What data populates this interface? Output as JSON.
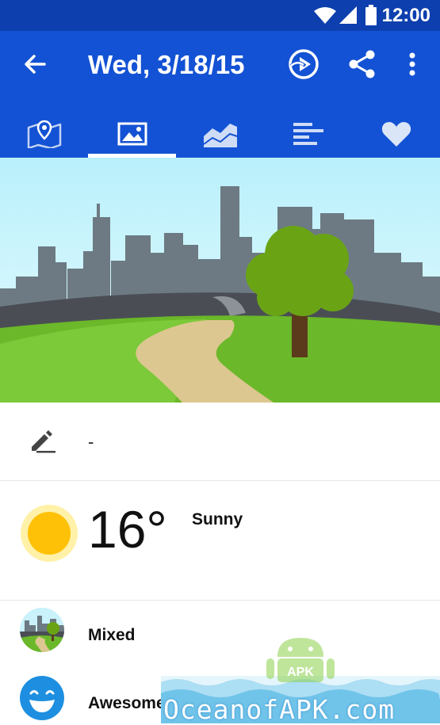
{
  "status": {
    "time": "12:00"
  },
  "toolbar": {
    "title": "Wed, 3/18/15",
    "back_icon": "arrow-back-icon",
    "actions": [
      "share-image-icon",
      "share-icon",
      "more-vert-icon"
    ]
  },
  "tabs": [
    {
      "icon": "map-icon",
      "active": false
    },
    {
      "icon": "image-icon",
      "active": true
    },
    {
      "icon": "chart-icon",
      "active": false
    },
    {
      "icon": "list-icon",
      "active": false
    },
    {
      "icon": "heart-icon",
      "active": false
    }
  ],
  "note": {
    "icon": "edit-icon",
    "text": "-"
  },
  "weather": {
    "icon": "sun-icon",
    "temperature": "16°",
    "condition": "Sunny"
  },
  "items": [
    {
      "label": "Mixed",
      "icon": "park-scene-icon"
    },
    {
      "label": "Awesome",
      "icon": "grinning-face-icon"
    }
  ],
  "watermark": {
    "text": "OceanofAPK.com",
    "badge": "APK"
  },
  "colors": {
    "status_bar": "#0d3fae",
    "toolbar": "#1352d4",
    "sun": "#ffc107",
    "grass": "#6bb82a"
  }
}
